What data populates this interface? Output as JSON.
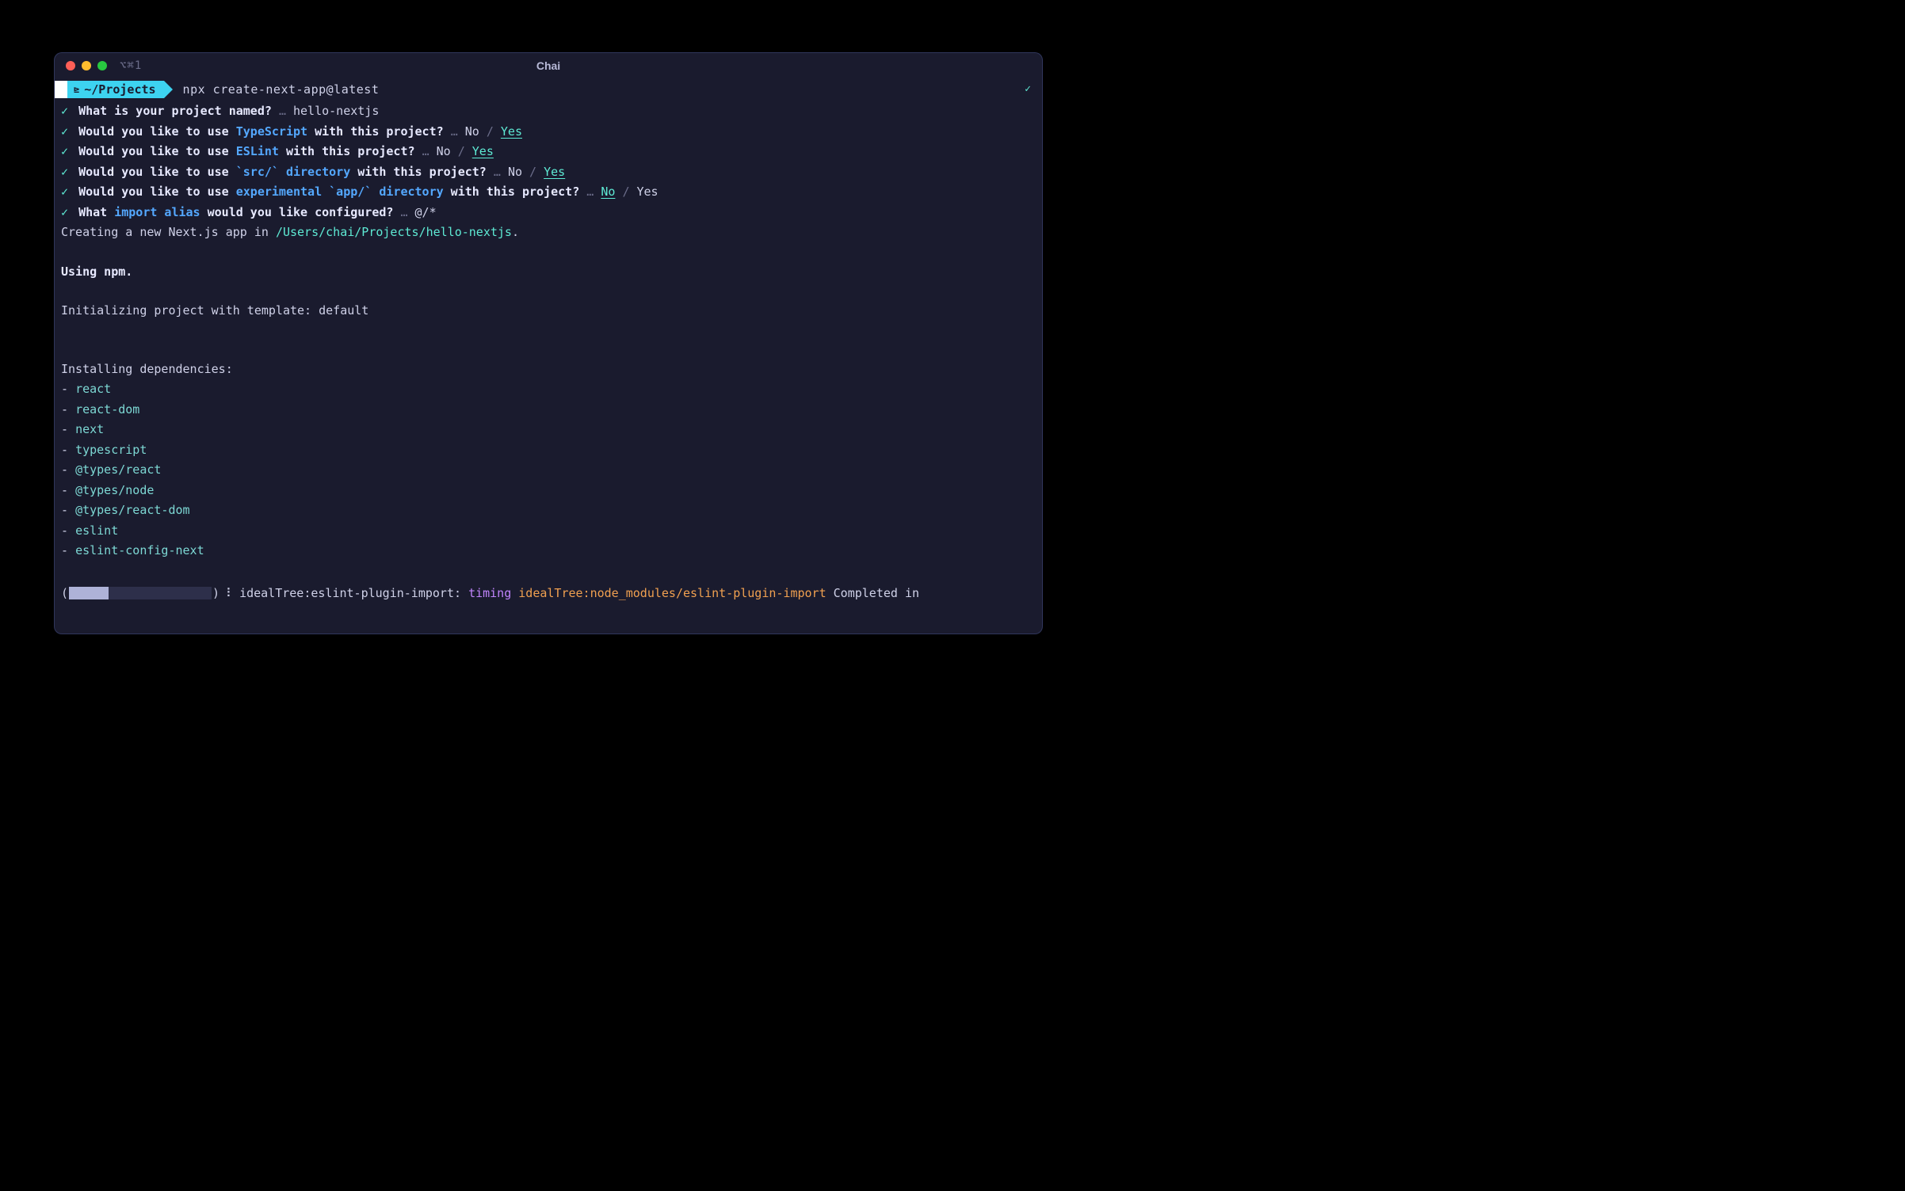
{
  "window": {
    "title": "Chai",
    "tab_indicator": "⌥⌘1"
  },
  "prompt": {
    "path": "~/Projects",
    "command": "npx create-next-app@latest"
  },
  "qa": [
    {
      "q_pre": "What is your project named?",
      "q_hl": "",
      "q_post": "",
      "ellipsis": "…",
      "answer": "hello-nextjs",
      "no": "",
      "yes": "",
      "sel": ""
    },
    {
      "q_pre": "Would you like to use ",
      "q_hl": "TypeScript",
      "q_post": " with this project?",
      "ellipsis": "…",
      "no": "No",
      "yes": "Yes",
      "sel": "yes"
    },
    {
      "q_pre": "Would you like to use ",
      "q_hl": "ESLint",
      "q_post": " with this project?",
      "ellipsis": "…",
      "no": "No",
      "yes": "Yes",
      "sel": "yes"
    },
    {
      "q_pre": "Would you like to use ",
      "q_hl": "`src/` directory",
      "q_post": " with this project?",
      "ellipsis": "…",
      "no": "No",
      "yes": "Yes",
      "sel": "yes"
    },
    {
      "q_pre": "Would you like to use ",
      "q_hl": "experimental `app/` directory",
      "q_post": " with this project?",
      "ellipsis": "…",
      "no": "No",
      "yes": "Yes",
      "sel": "no"
    },
    {
      "q_pre": "What ",
      "q_hl": "import alias",
      "q_post": " would you like configured?",
      "ellipsis": "…",
      "answer": "@/*",
      "no": "",
      "yes": "",
      "sel": ""
    }
  ],
  "status": {
    "creating_pre": "Creating a new Next.js app in ",
    "creating_path": "/Users/chai/Projects/hello-nextjs",
    "creating_post": ".",
    "using_npm": "Using npm.",
    "init_template": "Initializing project with template: default",
    "installing": "Installing dependencies:"
  },
  "dependencies": [
    "react",
    "react-dom",
    "next",
    "typescript",
    "@types/react",
    "@types/node",
    "@types/react-dom",
    "eslint",
    "eslint-config-next"
  ],
  "progress": {
    "spinner": "⠇",
    "tree_label": "idealTree:eslint-plugin-import:",
    "timing": "timing",
    "path": "idealTree:node_modules/eslint-plugin-import",
    "completed": "Completed in"
  }
}
